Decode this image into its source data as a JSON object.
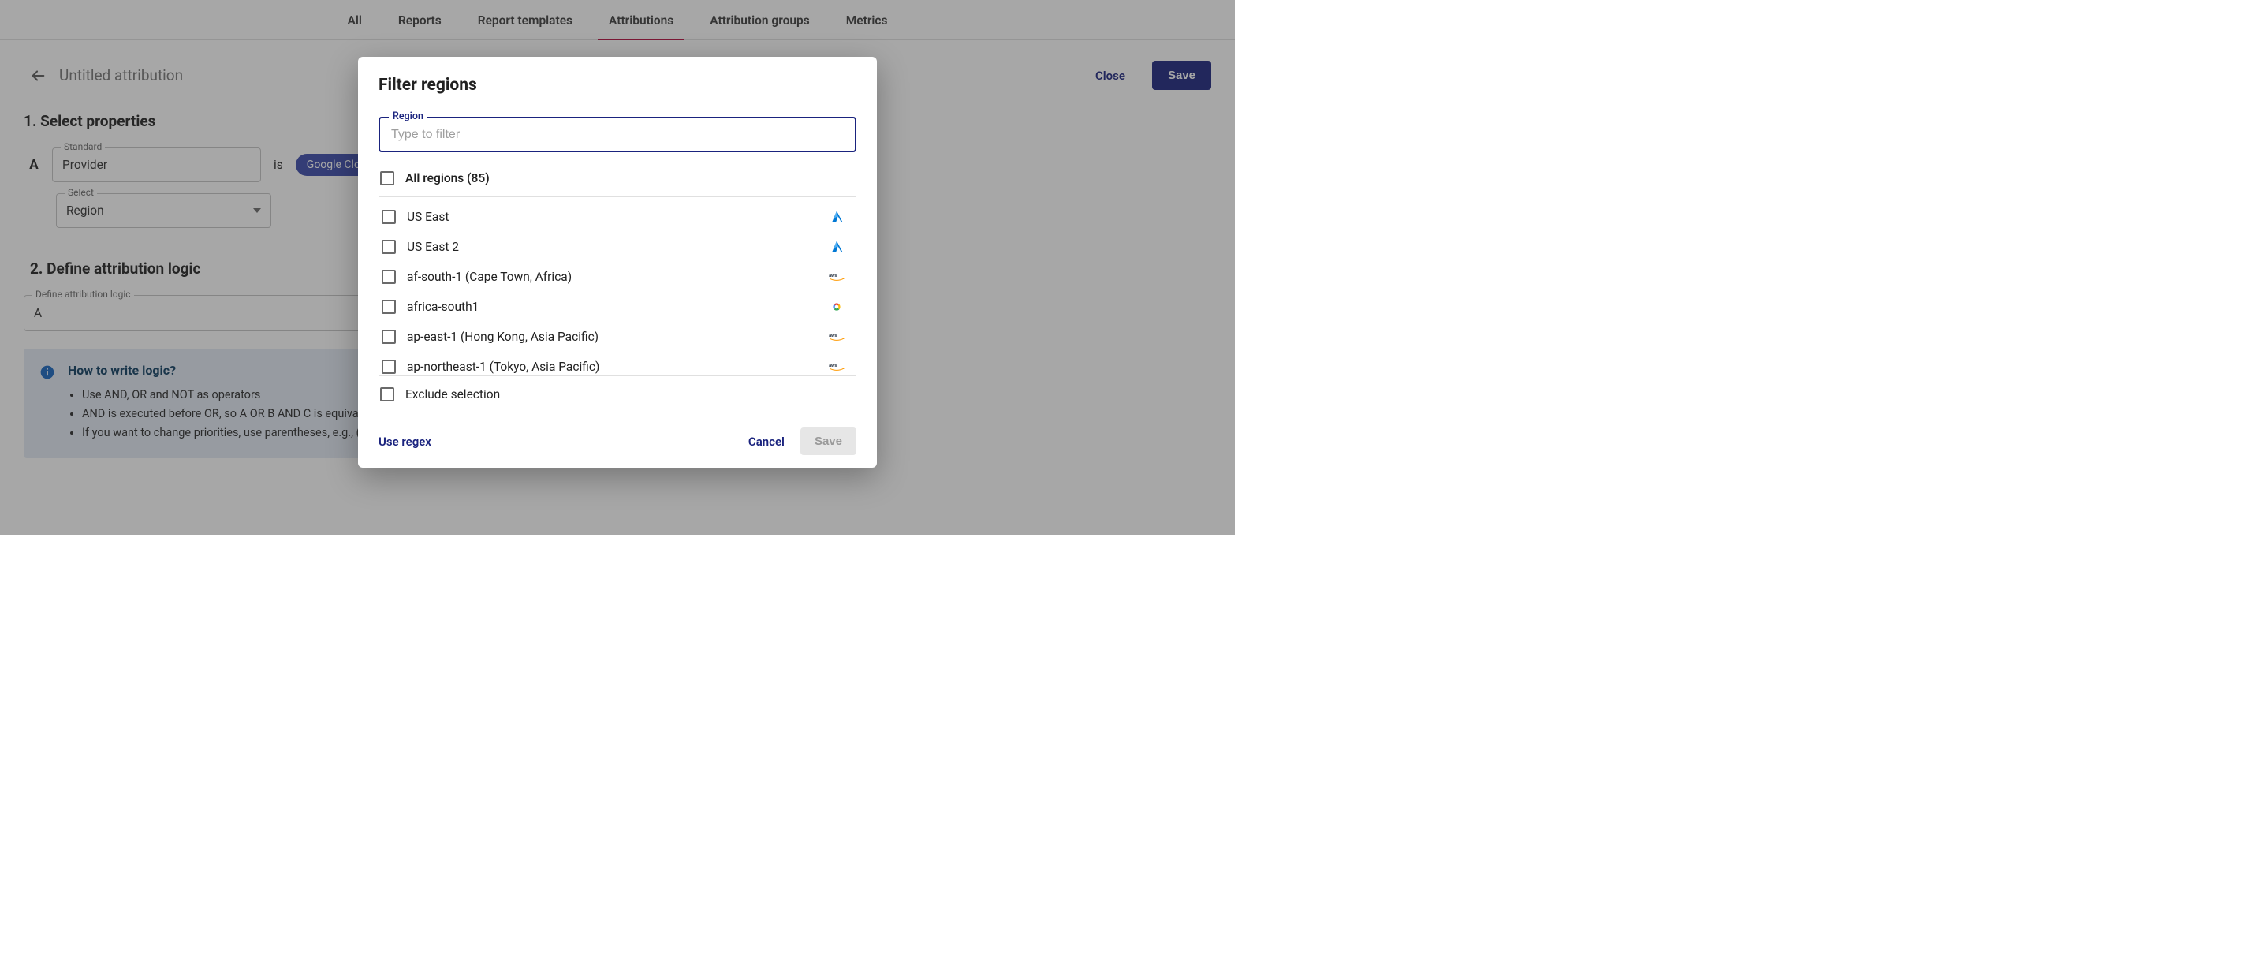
{
  "tabs": {
    "all": "All",
    "reports": "Reports",
    "templates": "Report templates",
    "attributions": "Attributions",
    "groups": "Attribution groups",
    "metrics": "Metrics"
  },
  "header": {
    "title": "Untitled attribution",
    "close": "Close",
    "save": "Save"
  },
  "section1": {
    "heading": "1. Select properties",
    "rowLetter": "A",
    "standardLabel": "Standard",
    "standardValue": "Provider",
    "isText": "is",
    "chip": "Google Cloud",
    "selectLabel": "Select",
    "selectValue": "Region"
  },
  "section2": {
    "heading": "2. Define attribution logic",
    "fieldLabel": "Define attribution logic",
    "fieldValue": "A"
  },
  "info": {
    "title": "How to write logic?",
    "items": [
      "Use AND, OR and NOT as operators",
      "AND is executed before OR, so A OR B AND C is equivalent to A OR (B AND C)",
      "If you want to change priorities, use parentheses, e.g., (A OR B) AND C"
    ]
  },
  "modal": {
    "title": "Filter regions",
    "regionLabel": "Region",
    "regionPlaceholder": "Type to filter",
    "allRegions": "All regions (85)",
    "exclude": "Exclude selection",
    "useRegex": "Use regex",
    "cancel": "Cancel",
    "save": "Save",
    "regions": [
      {
        "label": "US East",
        "provider": "azure"
      },
      {
        "label": "US East 2",
        "provider": "azure"
      },
      {
        "label": "af-south-1 (Cape Town, Africa)",
        "provider": "aws"
      },
      {
        "label": "africa-south1",
        "provider": "gcp"
      },
      {
        "label": "ap-east-1 (Hong Kong, Asia Pacific)",
        "provider": "aws"
      },
      {
        "label": "ap-northeast-1 (Tokyo, Asia Pacific)",
        "provider": "aws"
      }
    ]
  }
}
